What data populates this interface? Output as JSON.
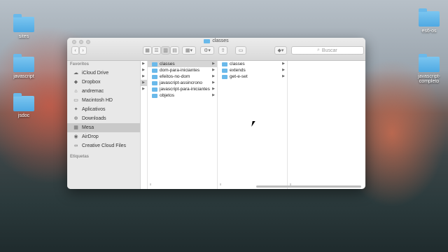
{
  "desktop": {
    "icons": [
      {
        "label": "sites"
      },
      {
        "label": "javascript"
      },
      {
        "label": "jsdoc"
      },
      {
        "label": "es6-os"
      },
      {
        "label": "javascript-completo"
      }
    ]
  },
  "window": {
    "title": "classes",
    "toolbar": {
      "back": "‹",
      "forward": "›",
      "search_placeholder": "Buscar"
    },
    "sidebar": {
      "favorites_heading": "Favoritos",
      "items": [
        {
          "label": "iCloud Drive",
          "icon": "cloud-icon"
        },
        {
          "label": "Dropbox",
          "icon": "dropbox-icon"
        },
        {
          "label": "andremac",
          "icon": "home-icon"
        },
        {
          "label": "Macintosh HD",
          "icon": "disk-icon"
        },
        {
          "label": "Aplicativos",
          "icon": "apps-icon"
        },
        {
          "label": "Downloads",
          "icon": "download-icon"
        },
        {
          "label": "Mesa",
          "icon": "desktop-icon"
        },
        {
          "label": "AirDrop",
          "icon": "airdrop-icon"
        },
        {
          "label": "Creative Cloud Files",
          "icon": "creative-cloud-icon"
        }
      ],
      "tags_heading": "Etiquetas"
    },
    "columns": [
      {
        "items": [
          "classes",
          "dom-para-iniciantes",
          "efeitos-no-dom",
          "javascript-assincrono",
          "javascript-para-iniciantes",
          "objetos"
        ]
      },
      {
        "items": [
          "classes",
          "extends",
          "get-e-set"
        ]
      }
    ]
  },
  "colors": {
    "folder": "#6ab9ea",
    "selection": "#d5d5d5"
  }
}
